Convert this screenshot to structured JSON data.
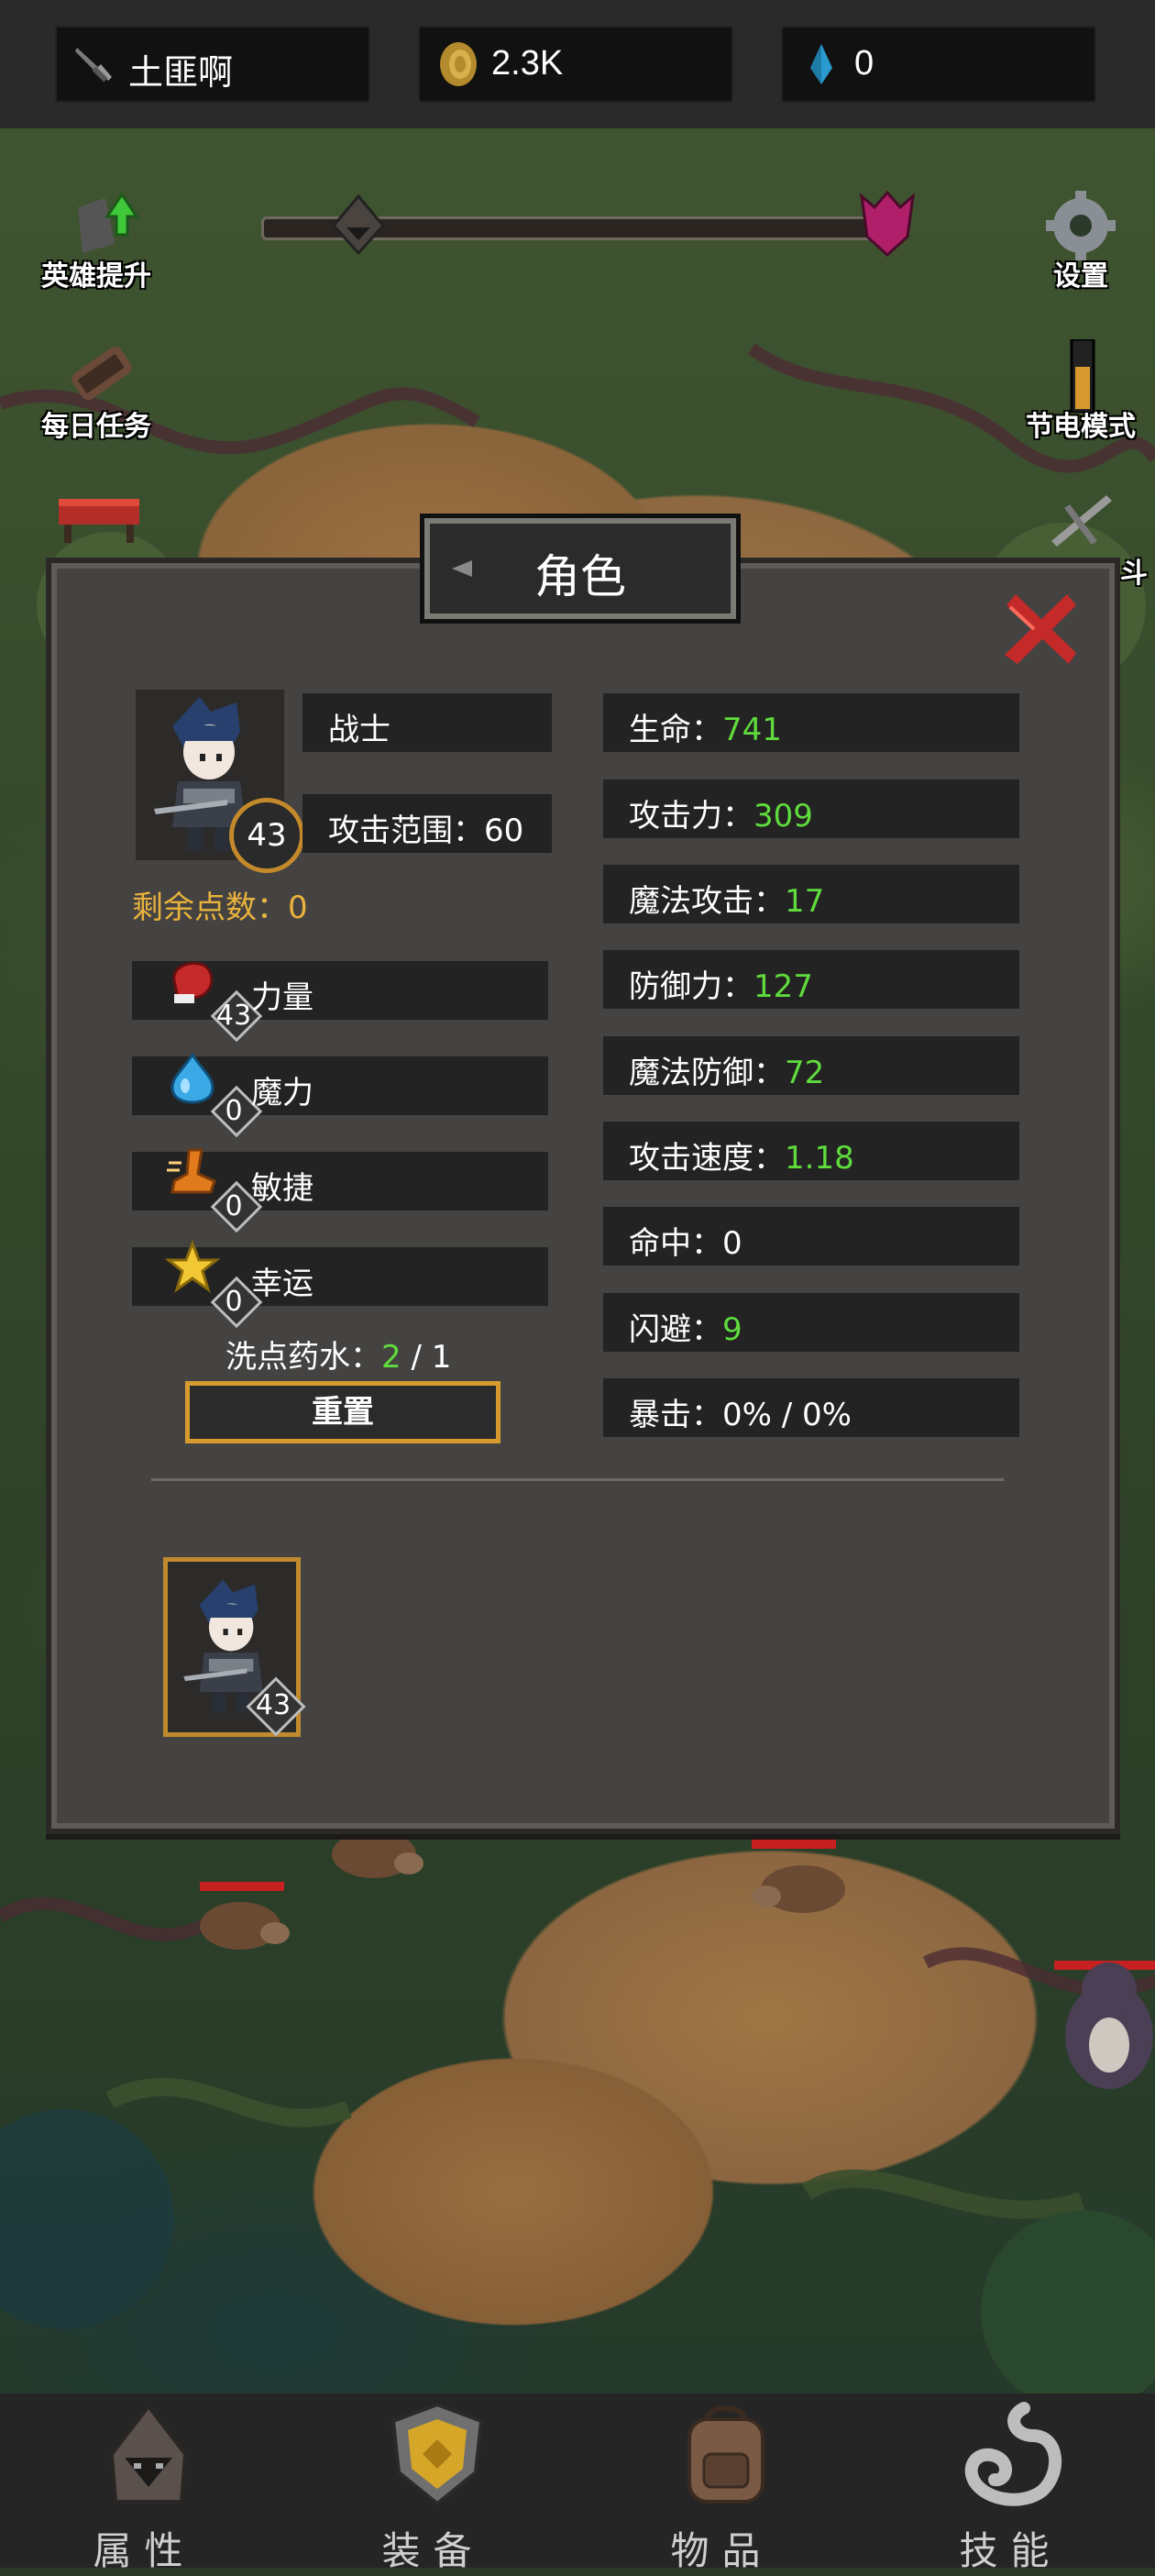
{
  "resources": {
    "player_name": "土匪啊",
    "gold": "2.3K",
    "gems": "0"
  },
  "side_buttons": {
    "hero_upgrade": "英雄提升",
    "daily_tasks": "每日任务",
    "settings": "设置",
    "power_saving": "节电模式",
    "battle_partial": "斗"
  },
  "panel": {
    "title": "角色",
    "class_name": "战士",
    "attack_range_label": "攻击范围：",
    "attack_range_value": "60",
    "level": "43",
    "remaining_points_label": "剩余点数：",
    "remaining_points_value": "0",
    "attributes": [
      {
        "name": "力量",
        "value": "43",
        "icon": "boxing-glove-icon"
      },
      {
        "name": "魔力",
        "value": "0",
        "icon": "mana-drop-icon"
      },
      {
        "name": "敏捷",
        "value": "0",
        "icon": "speed-boot-icon"
      },
      {
        "name": "幸运",
        "value": "0",
        "icon": "star-icon"
      }
    ],
    "potion_label": "洗点药水：",
    "potion_current": "2",
    "potion_sep": " / ",
    "potion_max": "1",
    "reset_label": "重置",
    "stats": [
      {
        "label": "生命：",
        "value": "741",
        "color": "#5fdc3c"
      },
      {
        "label": "攻击力：",
        "value": "309",
        "color": "#5fdc3c"
      },
      {
        "label": "魔法攻击：",
        "value": "17",
        "color": "#5fdc3c"
      },
      {
        "label": "防御力：",
        "value": "127",
        "color": "#5fdc3c"
      },
      {
        "label": "魔法防御：",
        "value": "72",
        "color": "#5fdc3c"
      },
      {
        "label": "攻击速度：",
        "value": "1.18",
        "color": "#5fdc3c"
      },
      {
        "label": "命中：",
        "value": "0",
        "color": "#ffffff"
      },
      {
        "label": "闪避：",
        "value": "9",
        "color": "#5fdc3c"
      },
      {
        "label": "暴击：",
        "value": "0% / 0%",
        "color": "#ffffff"
      }
    ],
    "hero_card_level": "43"
  },
  "bottom_nav": [
    {
      "label": "属性",
      "icon": "hood-icon"
    },
    {
      "label": "装备",
      "icon": "shield-icon"
    },
    {
      "label": "物品",
      "icon": "backpack-icon"
    },
    {
      "label": "技能",
      "icon": "swirl-icon"
    }
  ],
  "colors": {
    "accent_gold": "#d69a2e",
    "stat_green": "#5fdc3c",
    "points_yellow": "#e9b23c"
  }
}
